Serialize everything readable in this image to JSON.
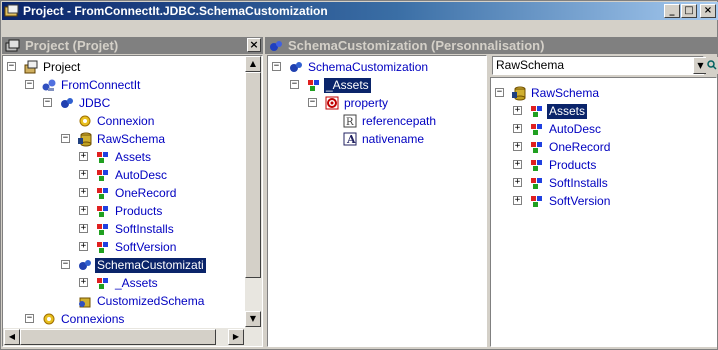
{
  "window": {
    "title": "Project - FromConnectIt.JDBC.SchemaCustomization",
    "buttons": {
      "minimize": "_",
      "maximize": "□",
      "close": "×"
    }
  },
  "left_pane": {
    "header": "Project (Projet)",
    "close_glyph": "×",
    "tree": [
      {
        "label": "Project",
        "style": "normal"
      },
      {
        "label": "FromConnectIt",
        "style": "blue"
      },
      {
        "label": "JDBC",
        "style": "blue"
      },
      {
        "label": "Connexion",
        "style": "blue"
      },
      {
        "label": "RawSchema",
        "style": "blue"
      },
      {
        "label": "Assets",
        "style": "blue"
      },
      {
        "label": "AutoDesc",
        "style": "blue"
      },
      {
        "label": "OneRecord",
        "style": "blue"
      },
      {
        "label": "Products",
        "style": "blue"
      },
      {
        "label": "SoftInstalls",
        "style": "blue"
      },
      {
        "label": "SoftVersion",
        "style": "blue"
      },
      {
        "label": "SchemaCustomizati",
        "style": "selected"
      },
      {
        "label": "_Assets",
        "style": "blue"
      },
      {
        "label": "CustomizedSchema",
        "style": "blue"
      },
      {
        "label": "Connexions",
        "style": "blue"
      }
    ]
  },
  "middle_pane": {
    "header": "SchemaCustomization (Personnalisation)",
    "tree": [
      {
        "label": "SchemaCustomization",
        "style": "blue"
      },
      {
        "label": "_Assets",
        "style": "selected"
      },
      {
        "label": "property",
        "style": "blue"
      },
      {
        "label": "referencepath",
        "style": "blue"
      },
      {
        "label": "nativename",
        "style": "blue"
      }
    ]
  },
  "right_pane": {
    "combo_value": "RawSchema",
    "tree": [
      {
        "label": "RawSchema",
        "style": "blue"
      },
      {
        "label": "Assets",
        "style": "selected"
      },
      {
        "label": "AutoDesc",
        "style": "blue"
      },
      {
        "label": "OneRecord",
        "style": "blue"
      },
      {
        "label": "Products",
        "style": "blue"
      },
      {
        "label": "SoftInstalls",
        "style": "blue"
      },
      {
        "label": "SoftVersion",
        "style": "blue"
      }
    ]
  },
  "scroll_glyphs": {
    "up": "▲",
    "down": "▼",
    "left": "◀",
    "right": "▶",
    "dropdown": "▼"
  },
  "expander_glyphs": {
    "expanded": "−",
    "collapsed": "+"
  },
  "colors": {
    "link": "#0000c0",
    "selection": "#0a246a",
    "title_start": "#0a246a",
    "title_end": "#a6caf0"
  }
}
